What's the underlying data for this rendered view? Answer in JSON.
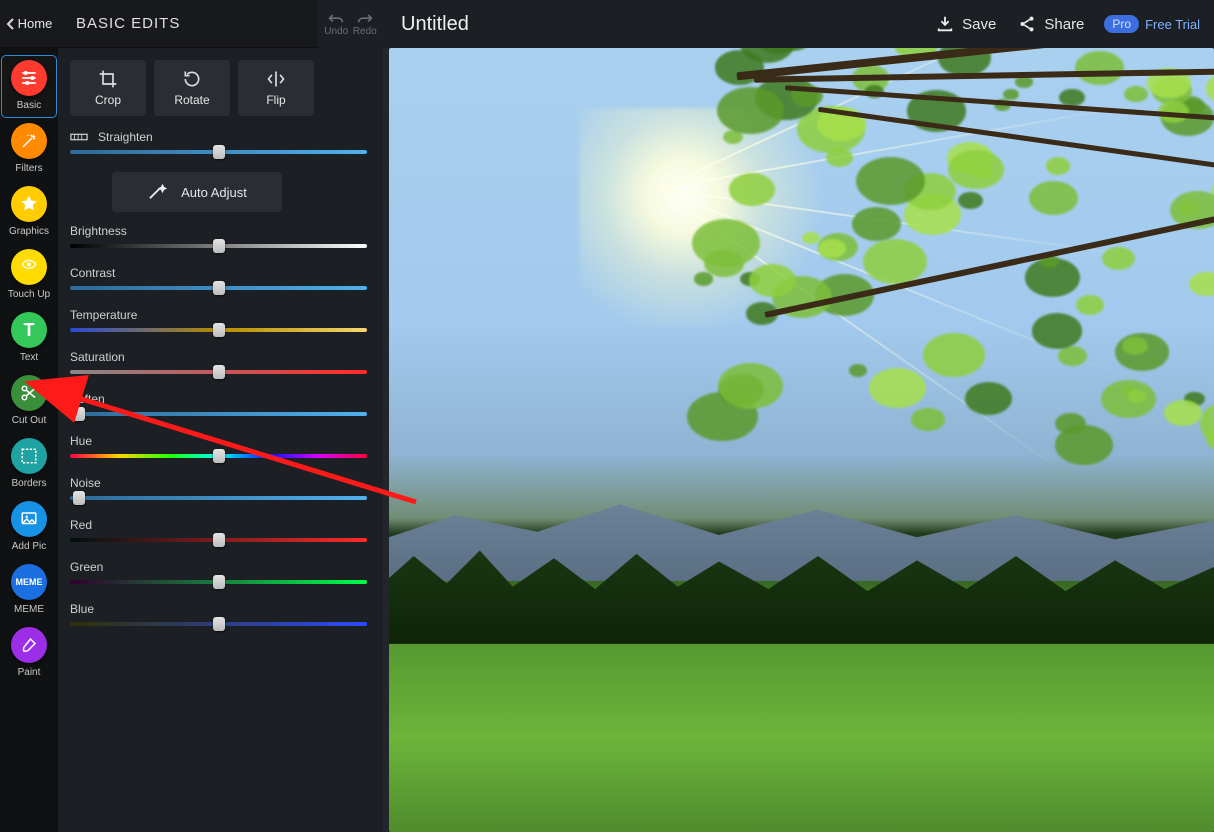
{
  "header": {
    "home": "Home",
    "panel_title": "BASIC EDITS",
    "undo": "Undo",
    "redo": "Redo",
    "doc_title": "Untitled",
    "save": "Save",
    "share": "Share",
    "pro": "Pro",
    "trial": "Free Trial"
  },
  "dock": {
    "items": [
      {
        "label": "Basic",
        "color": "#ff3b2f",
        "icon": "sliders"
      },
      {
        "label": "Filters",
        "color": "#ff8a00",
        "icon": "wand"
      },
      {
        "label": "Graphics",
        "color": "#ffcc00",
        "icon": "star"
      },
      {
        "label": "Touch Up",
        "color": "#ffdc00",
        "icon": "eye"
      },
      {
        "label": "Text",
        "color": "#34c759",
        "icon": "T"
      },
      {
        "label": "Cut Out",
        "color": "#3a8f3a",
        "icon": "scissors"
      },
      {
        "label": "Borders",
        "color": "#1fa2a2",
        "icon": "frame"
      },
      {
        "label": "Add Pic",
        "color": "#1793e6",
        "icon": "picture"
      },
      {
        "label": "MEME",
        "color": "#1b6fe0",
        "icon": "MEME"
      },
      {
        "label": "Paint",
        "color": "#9b2ee6",
        "icon": "brush"
      }
    ]
  },
  "tools": {
    "crop": "Crop",
    "rotate": "Rotate",
    "flip": "Flip",
    "auto_adjust": "Auto Adjust"
  },
  "sliders": [
    {
      "label": "Straighten",
      "pos": 50,
      "style": "plain",
      "icon": true
    },
    {
      "label": "Brightness",
      "pos": 50,
      "style": "bright"
    },
    {
      "label": "Contrast",
      "pos": 50,
      "style": "plain"
    },
    {
      "label": "Temperature",
      "pos": 50,
      "style": "temp"
    },
    {
      "label": "Saturation",
      "pos": 50,
      "style": "sat"
    },
    {
      "label": "Soften",
      "pos": 3,
      "style": "plain"
    },
    {
      "label": "Hue",
      "pos": 50,
      "style": "hue"
    },
    {
      "label": "Noise",
      "pos": 3,
      "style": "plain"
    },
    {
      "label": "Red",
      "pos": 50,
      "style": "red"
    },
    {
      "label": "Green",
      "pos": 50,
      "style": "green"
    },
    {
      "label": "Blue",
      "pos": 50,
      "style": "blue"
    }
  ],
  "annotation": {
    "type": "arrow",
    "from": {
      "note": "canvas-area"
    },
    "to": {
      "note": "dock-item Cut Out"
    },
    "color": "#ff1a1a"
  }
}
